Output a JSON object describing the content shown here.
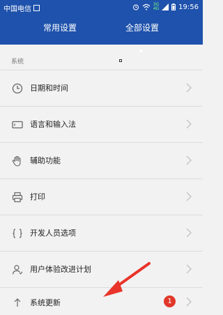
{
  "status_bar": {
    "carrier": "中国电信",
    "time": "19:56",
    "net_type_top": "3G",
    "net_type_bottom": "4G"
  },
  "tabs": [
    {
      "label": "常用设置",
      "active": false
    },
    {
      "label": "全部设置",
      "active": true
    }
  ],
  "section": {
    "title": "系统"
  },
  "items": [
    {
      "label": "日期和时间",
      "icon": "clock-icon"
    },
    {
      "label": "语言和输入法",
      "icon": "keyboard-icon"
    },
    {
      "label": "辅助功能",
      "icon": "hand-icon"
    },
    {
      "label": "打印",
      "icon": "printer-icon"
    },
    {
      "label": "开发人员选项",
      "icon": "braces-icon"
    },
    {
      "label": "用户体验改进计划",
      "icon": "user-icon"
    },
    {
      "label": "系统更新",
      "icon": "arrow-up-icon",
      "badge": "1"
    }
  ],
  "colors": {
    "header_bg": "#1e52ac",
    "badge": "#e0382a",
    "annotation_arrow": "#e8342a"
  }
}
